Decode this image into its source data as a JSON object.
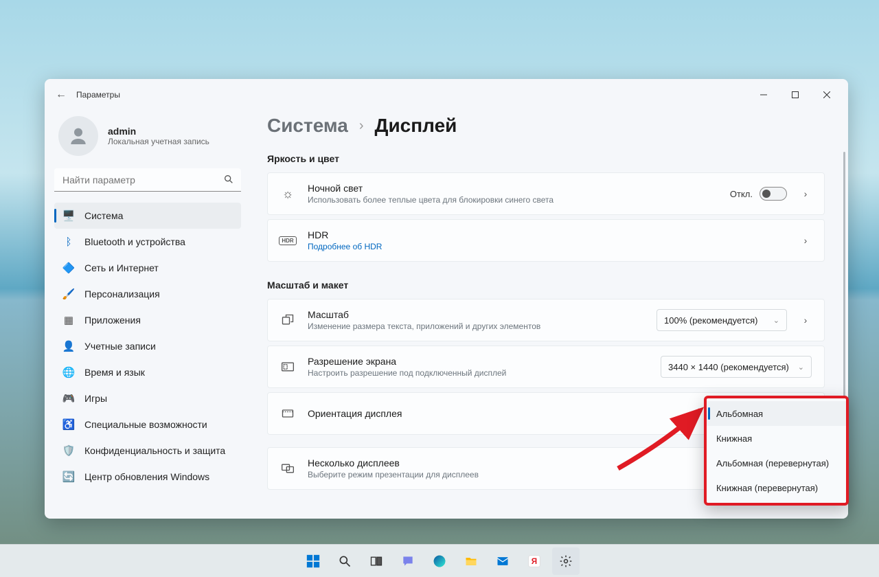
{
  "window": {
    "title": "Параметры",
    "account": {
      "name": "admin",
      "sub": "Локальная учетная запись"
    },
    "search_placeholder": "Найти параметр"
  },
  "nav": [
    {
      "label": "Система",
      "icon": "🖥️",
      "color": "#0067c0",
      "active": true
    },
    {
      "label": "Bluetooth и устройства",
      "icon": "ᛒ",
      "color": "#0067c0"
    },
    {
      "label": "Сеть и Интернет",
      "icon": "🔷",
      "color": "#0ea5e9"
    },
    {
      "label": "Персонализация",
      "icon": "🖌️",
      "color": "#d97706"
    },
    {
      "label": "Приложения",
      "icon": "▦",
      "color": "#555"
    },
    {
      "label": "Учетные записи",
      "icon": "👤",
      "color": "#16a34a"
    },
    {
      "label": "Время и язык",
      "icon": "🌐",
      "color": "#555"
    },
    {
      "label": "Игры",
      "icon": "🎮",
      "color": "#555"
    },
    {
      "label": "Специальные возможности",
      "icon": "♿",
      "color": "#0067c0"
    },
    {
      "label": "Конфиденциальность и защита",
      "icon": "🛡️",
      "color": "#555"
    },
    {
      "label": "Центр обновления Windows",
      "icon": "🔄",
      "color": "#0ea5e9"
    }
  ],
  "breadcrumb": {
    "parent": "Система",
    "current": "Дисплей"
  },
  "sections": {
    "s1": "Яркость и цвет",
    "s2": "Масштаб и макет"
  },
  "cards": {
    "nightlight": {
      "title": "Ночной свет",
      "sub": "Использовать более теплые цвета для блокировки синего света",
      "toggle": "Откл."
    },
    "hdr": {
      "title": "HDR",
      "link": "Подробнее об HDR"
    },
    "scale": {
      "title": "Масштаб",
      "sub": "Изменение размера текста, приложений и других элементов",
      "value": "100% (рекомендуется)"
    },
    "resolution": {
      "title": "Разрешение экрана",
      "sub": "Настроить разрешение под подключенный дисплей",
      "value": "3440 × 1440 (рекомендуется)"
    },
    "orientation": {
      "title": "Ориентация дисплея"
    },
    "multi": {
      "title": "Несколько дисплеев",
      "sub": "Выберите режим презентации для дисплеев"
    }
  },
  "dropdown": {
    "options": [
      "Альбомная",
      "Книжная",
      "Альбомная (перевернутая)",
      "Книжная (перевернутая)"
    ],
    "selected": 0
  },
  "taskbar": [
    "start",
    "search",
    "taskview",
    "chat",
    "edge",
    "explorer",
    "mail",
    "yandex",
    "settings"
  ]
}
